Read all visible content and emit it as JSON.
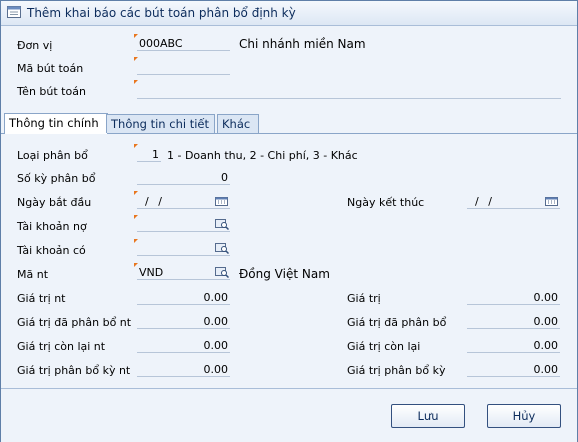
{
  "window": {
    "title": "Thêm khai báo các bút toán phân bổ định kỳ"
  },
  "header": {
    "don_vi_label": "Đơn vị",
    "don_vi_value": "000ABC",
    "don_vi_name": "Chi nhánh miền Nam",
    "ma_but_toan_label": "Mã bút toán",
    "ma_but_toan_value": "",
    "ten_but_toan_label": "Tên bút toán",
    "ten_but_toan_value": ""
  },
  "tabs": [
    {
      "label": "Thông tin chính",
      "active": true
    },
    {
      "label": "Thông tin chi tiết",
      "active": false
    },
    {
      "label": "Khác",
      "active": false
    }
  ],
  "form": {
    "loai_phan_bo_label": "Loại phân bổ",
    "loai_phan_bo_value": "1",
    "loai_phan_bo_hint": "1 - Doanh thu, 2 - Chi phí, 3 - Khác",
    "so_ky_label": "Số kỳ phân bổ",
    "so_ky_value": "0",
    "ngay_bat_dau_label": "Ngày bắt đầu",
    "ngay_bat_dau_value": "/ /",
    "ngay_ket_thuc_label": "Ngày kết thúc",
    "ngay_ket_thuc_value": "/ /",
    "tk_no_label": "Tài khoản nợ",
    "tk_no_value": "",
    "tk_co_label": "Tài khoản có",
    "tk_co_value": "",
    "ma_nt_label": "Mã nt",
    "ma_nt_value": "VND",
    "ma_nt_name": "Đồng Việt Nam",
    "gia_tri_nt_label": "Giá trị nt",
    "gia_tri_nt_value": "0.00",
    "gia_tri_label": "Giá trị",
    "gia_tri_value": "0.00",
    "gt_da_pb_nt_label": "Giá trị đã phân bổ nt",
    "gt_da_pb_nt_value": "0.00",
    "gt_da_pb_label": "Giá trị đã phân bổ",
    "gt_da_pb_value": "0.00",
    "gt_con_lai_nt_label": "Giá trị còn lại nt",
    "gt_con_lai_nt_value": "0.00",
    "gt_con_lai_label": "Giá trị còn lại",
    "gt_con_lai_value": "0.00",
    "gt_pb_ky_nt_label": "Giá trị phân bổ kỳ nt",
    "gt_pb_ky_nt_value": "0.00",
    "gt_pb_ky_label": "Giá trị phân bổ kỳ",
    "gt_pb_ky_value": "0.00"
  },
  "buttons": {
    "save": "Lưu",
    "cancel": "Hủy"
  },
  "icons": {
    "title": "form-icon",
    "calendar": "calendar-icon",
    "lookup": "lookup-icon"
  },
  "colors": {
    "accent": "#0c2c5c",
    "required_marker": "#e8761e",
    "background": "#eef3fa"
  }
}
